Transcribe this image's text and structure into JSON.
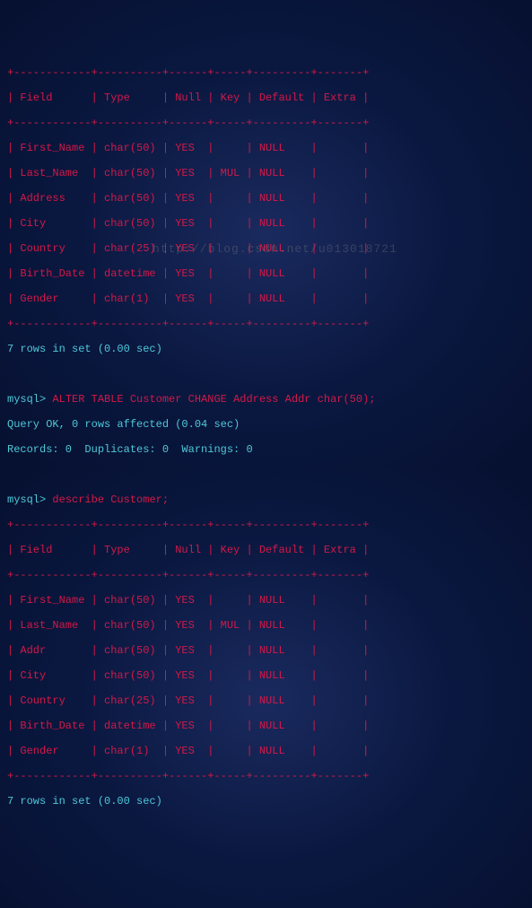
{
  "table1": {
    "border_hdr": "+------------+----------+------+-----+---------+-------+",
    "header": "| Field      | Type     | Null | Key | Default | Extra |",
    "rows": [
      "| First_Name | char(50) | YES  |     | NULL    |       |",
      "| Last_Name  | char(50) | YES  | MUL | NULL    |       |",
      "| Address    | char(50) | YES  |     | NULL    |       |",
      "| City       | char(50) | YES  |     | NULL    |       |",
      "| Country    | char(25) | YES  |     | NULL    |       |",
      "| Birth_Date | datetime | YES  |     | NULL    |       |",
      "| Gender     | char(1)  | YES  |     | NULL    |       |"
    ],
    "summary": "7 rows in set (0.00 sec)"
  },
  "cmd1": {
    "prompt": "mysql> ",
    "sql": "ALTER TABLE Customer CHANGE Address Addr char(50);",
    "result1": "Query OK, 0 rows affected (0.04 sec)",
    "result2": "Records: 0  Duplicates: 0  Warnings: 0"
  },
  "cmd2": {
    "prompt": "mysql> ",
    "sql": "describe Customer;"
  },
  "table2": {
    "border_hdr": "+------------+----------+------+-----+---------+-------+",
    "header": "| Field      | Type     | Null | Key | Default | Extra |",
    "rows": [
      "| First_Name | char(50) | YES  |     | NULL    |       |",
      "| Last_Name  | char(50) | YES  | MUL | NULL    |       |",
      "| Addr       | char(50) | YES  |     | NULL    |       |",
      "| City       | char(50) | YES  |     | NULL    |       |",
      "| Country    | char(25) | YES  |     | NULL    |       |",
      "| Birth_Date | datetime | YES  |     | NULL    |       |",
      "| Gender     | char(1)  | YES  |     | NULL    |       |"
    ],
    "summary": "7 rows in set (0.00 sec)"
  },
  "watermark": "http://blog.csdn.net/u013018721"
}
